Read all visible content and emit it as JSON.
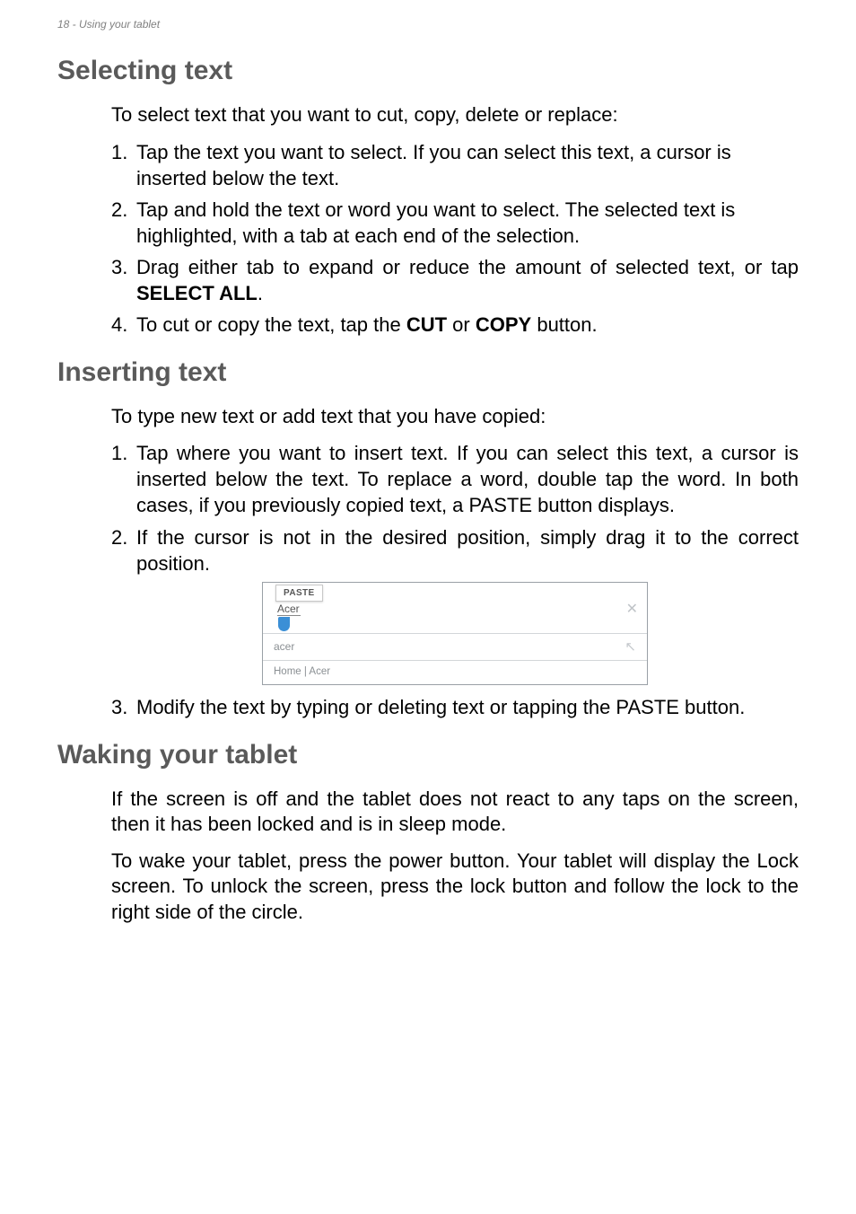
{
  "header": {
    "running": "18 - Using your tablet"
  },
  "sections": {
    "selecting": {
      "title": "Selecting text",
      "intro": "To select text that you want to cut, copy, delete or replace:",
      "steps": {
        "s1": "Tap the text you want to select. If you can select this text, a cursor is inserted below the text.",
        "s2": "Tap and hold the text or word you want to select. The selected text is highlighted, with a tab at each end of the selection.",
        "s3_a": "Drag either tab to expand or reduce the amount of selected text, or tap ",
        "s3_bold": "SELECT ALL",
        "s3_b": ".",
        "s4_a": "To cut or copy the text, tap the ",
        "s4_bold1": "CUT",
        "s4_mid": " or ",
        "s4_bold2": "COPY",
        "s4_b": " button."
      }
    },
    "inserting": {
      "title": "Inserting text",
      "intro": "To type new text or add text that you have copied:",
      "steps": {
        "s1": "Tap where you want to insert text. If you can select this text, a cursor is inserted below the text. To replace a word, double tap the word. In both cases, if you previously copied text, a PASTE button displays.",
        "s2": "If the cursor is not in the desired position, simply drag it to the correct position.",
        "s3": "Modify the text by typing or deleting text or tapping the PASTE button."
      }
    },
    "waking": {
      "title": "Waking your tablet",
      "p1": "If the screen is off and the tablet does not react to any taps on the screen, then it has been locked and is in sleep mode.",
      "p2": "To wake your tablet, press the power button. Your tablet will display the Lock screen. To unlock the screen, press the lock button and follow the lock to the right side of the circle."
    }
  },
  "figure": {
    "paste_label": "PASTE",
    "typed": "Acer",
    "close_glyph": "✕",
    "suggestion1": "acer",
    "arrow_glyph": "↖",
    "suggestion2": "Home | Acer"
  }
}
